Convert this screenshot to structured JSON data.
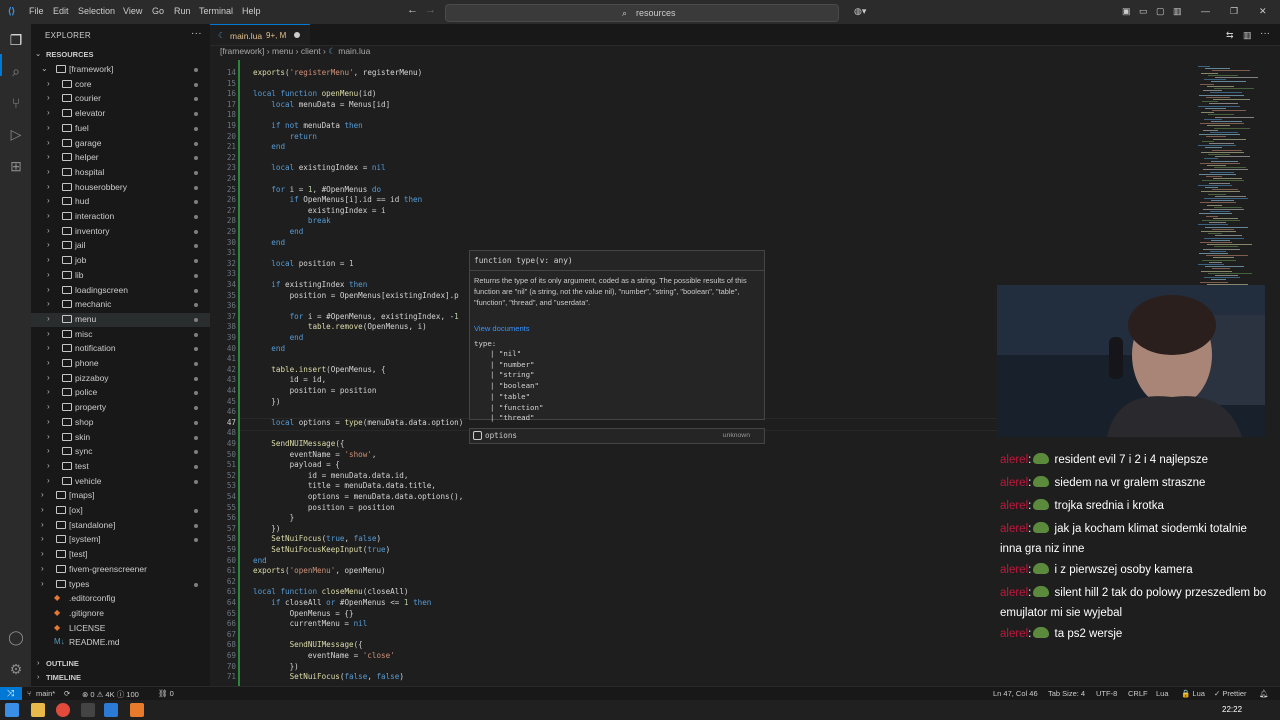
{
  "menubar": {
    "items": [
      "File",
      "Edit",
      "Selection",
      "View",
      "Go",
      "Run",
      "Terminal",
      "Help"
    ],
    "search_text": "resources"
  },
  "sidebar": {
    "title": "EXPLORER",
    "root": "RESOURCES",
    "tree": [
      {
        "label": "[framework]",
        "type": "folder",
        "open": true,
        "depth": 1,
        "dot": true
      },
      {
        "label": "core",
        "type": "folder",
        "depth": 2,
        "dot": true
      },
      {
        "label": "courier",
        "type": "folder",
        "depth": 2,
        "dot": true
      },
      {
        "label": "elevator",
        "type": "folder",
        "depth": 2,
        "dot": true
      },
      {
        "label": "fuel",
        "type": "folder",
        "depth": 2,
        "dot": true
      },
      {
        "label": "garage",
        "type": "folder",
        "depth": 2,
        "dot": true
      },
      {
        "label": "helper",
        "type": "folder",
        "depth": 2,
        "dot": true
      },
      {
        "label": "hospital",
        "type": "folder",
        "depth": 2,
        "dot": true
      },
      {
        "label": "houserobbery",
        "type": "folder",
        "depth": 2,
        "dot": true
      },
      {
        "label": "hud",
        "type": "folder",
        "depth": 2,
        "dot": true
      },
      {
        "label": "interaction",
        "type": "folder",
        "depth": 2,
        "dot": true
      },
      {
        "label": "inventory",
        "type": "folder",
        "depth": 2,
        "dot": true
      },
      {
        "label": "jail",
        "type": "folder",
        "depth": 2,
        "dot": true
      },
      {
        "label": "job",
        "type": "folder",
        "depth": 2,
        "dot": true
      },
      {
        "label": "lib",
        "type": "folder",
        "depth": 2,
        "dot": true
      },
      {
        "label": "loadingscreen",
        "type": "folder",
        "depth": 2,
        "dot": true
      },
      {
        "label": "mechanic",
        "type": "folder",
        "depth": 2,
        "dot": true
      },
      {
        "label": "menu",
        "type": "folder",
        "depth": 2,
        "dot": true,
        "selected": true
      },
      {
        "label": "misc",
        "type": "folder",
        "depth": 2,
        "dot": true
      },
      {
        "label": "notification",
        "type": "folder",
        "depth": 2,
        "dot": true
      },
      {
        "label": "phone",
        "type": "folder",
        "depth": 2,
        "dot": true
      },
      {
        "label": "pizzaboy",
        "type": "folder",
        "depth": 2,
        "dot": true
      },
      {
        "label": "police",
        "type": "folder",
        "depth": 2,
        "dot": true
      },
      {
        "label": "property",
        "type": "folder",
        "depth": 2,
        "dot": true
      },
      {
        "label": "shop",
        "type": "folder",
        "depth": 2,
        "dot": true
      },
      {
        "label": "skin",
        "type": "folder",
        "depth": 2,
        "dot": true
      },
      {
        "label": "sync",
        "type": "folder",
        "depth": 2,
        "dot": true
      },
      {
        "label": "test",
        "type": "folder",
        "depth": 2,
        "dot": true
      },
      {
        "label": "vehicle",
        "type": "folder",
        "depth": 2,
        "dot": true
      },
      {
        "label": "[maps]",
        "type": "folder",
        "depth": 1,
        "dot": false
      },
      {
        "label": "[ox]",
        "type": "folder",
        "depth": 1,
        "dot": true
      },
      {
        "label": "[standalone]",
        "type": "folder",
        "depth": 1,
        "dot": true
      },
      {
        "label": "[system]",
        "type": "folder",
        "depth": 1,
        "dot": true
      },
      {
        "label": "[test]",
        "type": "folder",
        "depth": 1,
        "dot": false
      },
      {
        "label": "fivem-greenscreener",
        "type": "folder",
        "depth": 1,
        "dot": false
      },
      {
        "label": "types",
        "type": "folder",
        "depth": 1,
        "dot": true
      },
      {
        "label": ".editorconfig",
        "type": "file",
        "depth": 1,
        "dot": false
      },
      {
        "label": ".gitignore",
        "type": "file",
        "depth": 1,
        "dot": false
      },
      {
        "label": "LICENSE",
        "type": "file",
        "depth": 1,
        "dot": false
      },
      {
        "label": "README.md",
        "type": "file",
        "depth": 1,
        "dot": false,
        "prefix": "M↓"
      }
    ],
    "outline_label": "OUTLINE",
    "timeline_label": "TIMELINE"
  },
  "tab": {
    "label": "main.lua",
    "badge": "9+, M"
  },
  "breadcrumb": [
    "[framework]",
    "menu",
    "client",
    "main.lua"
  ],
  "editor": {
    "current_line": 47,
    "lines": [
      {
        "n": 14,
        "t": "exports('registerMenu', registerMenu)"
      },
      {
        "n": 15,
        "t": ""
      },
      {
        "n": 16,
        "t": "local function openMenu(id)"
      },
      {
        "n": 17,
        "t": "    local menuData = Menus[id]"
      },
      {
        "n": 18,
        "t": ""
      },
      {
        "n": 19,
        "t": "    if not menuData then"
      },
      {
        "n": 20,
        "t": "        return"
      },
      {
        "n": 21,
        "t": "    end"
      },
      {
        "n": 22,
        "t": ""
      },
      {
        "n": 23,
        "t": "    local existingIndex = nil"
      },
      {
        "n": 24,
        "t": ""
      },
      {
        "n": 25,
        "t": "    for i = 1, #OpenMenus do"
      },
      {
        "n": 26,
        "t": "        if OpenMenus[i].id == id then"
      },
      {
        "n": 27,
        "t": "            existingIndex = i"
      },
      {
        "n": 28,
        "t": "            break"
      },
      {
        "n": 29,
        "t": "        end"
      },
      {
        "n": 30,
        "t": "    end"
      },
      {
        "n": 31,
        "t": ""
      },
      {
        "n": 32,
        "t": "    local position = 1"
      },
      {
        "n": 33,
        "t": ""
      },
      {
        "n": 34,
        "t": "    if existingIndex then"
      },
      {
        "n": 35,
        "t": "        position = OpenMenus[existingIndex].p"
      },
      {
        "n": 36,
        "t": ""
      },
      {
        "n": 37,
        "t": "        for i = #OpenMenus, existingIndex, -1"
      },
      {
        "n": 38,
        "t": "            table.remove(OpenMenus, i)"
      },
      {
        "n": 39,
        "t": "        end"
      },
      {
        "n": 40,
        "t": "    end"
      },
      {
        "n": 41,
        "t": ""
      },
      {
        "n": 42,
        "t": "    table.insert(OpenMenus, {"
      },
      {
        "n": 43,
        "t": "        id = id,"
      },
      {
        "n": 44,
        "t": "        position = position"
      },
      {
        "n": 45,
        "t": "    })"
      },
      {
        "n": 46,
        "t": ""
      },
      {
        "n": 47,
        "t": "    local options = type(menuData.data.option)"
      },
      {
        "n": 48,
        "t": ""
      },
      {
        "n": 49,
        "t": "    SendNUIMessage({"
      },
      {
        "n": 50,
        "t": "        eventName = 'show',"
      },
      {
        "n": 51,
        "t": "        payload = {"
      },
      {
        "n": 52,
        "t": "            id = menuData.data.id,"
      },
      {
        "n": 53,
        "t": "            title = menuData.data.title,"
      },
      {
        "n": 54,
        "t": "            options = menuData.data.options(),"
      },
      {
        "n": 55,
        "t": "            position = position"
      },
      {
        "n": 56,
        "t": "        }"
      },
      {
        "n": 57,
        "t": "    })"
      },
      {
        "n": 58,
        "t": "    SetNuiFocus(true, false)"
      },
      {
        "n": 59,
        "t": "    SetNuiFocusKeepInput(true)"
      },
      {
        "n": 60,
        "t": "end"
      },
      {
        "n": 61,
        "t": "exports('openMenu', openMenu)"
      },
      {
        "n": 62,
        "t": ""
      },
      {
        "n": 63,
        "t": "local function closeMenu(closeAll)"
      },
      {
        "n": 64,
        "t": "    if closeAll or #OpenMenus <= 1 then"
      },
      {
        "n": 65,
        "t": "        OpenMenus = {}"
      },
      {
        "n": 66,
        "t": "        currentMenu = nil"
      },
      {
        "n": 67,
        "t": ""
      },
      {
        "n": 68,
        "t": "        SendNUIMessage({"
      },
      {
        "n": 69,
        "t": "            eventName = 'close'"
      },
      {
        "n": 70,
        "t": "        })"
      },
      {
        "n": 71,
        "t": "        SetNuiFocus(false, false)"
      }
    ]
  },
  "hover": {
    "signature": "function type(v: any)",
    "description": "Returns the type of its only argument, coded as a string. The possible results of this function are \"nil\" (a string, not the value nil), \"number\", \"string\", \"boolean\", \"table\", \"function\", \"thread\", and \"userdata\".",
    "link": "View documents",
    "type_label": "type:",
    "type_values": [
      "| \"nil\"",
      "| \"number\"",
      "| \"string\"",
      "| \"boolean\"",
      "| \"table\"",
      "| \"function\"",
      "| \"thread\""
    ]
  },
  "suggest": {
    "label": "options",
    "detail": "unknown"
  },
  "chat": {
    "user": "alerel",
    "messages": [
      "resident evil 7 i 2 i 4 najlepsze",
      "siedem na vr gralem straszne",
      "trojka srednia i krotka",
      "jak ja kocham klimat siodemki totalnie inna gra niz inne",
      "i z pierwszej osoby kamera",
      "silent hill 2 tak do polowy przeszedlem bo emujlator mi sie wyjebal",
      "ta ps2 wersje"
    ]
  },
  "statusbar": {
    "branch": "main*",
    "problems": "⊗ 0 ⚠ 4K ⓘ 100",
    "ports": "⛓ 0",
    "position": "Ln 47, Col 46",
    "tab_size": "Tab Size: 4",
    "encoding": "UTF-8",
    "eol": "CRLF",
    "language": "Lua",
    "formatter_lang": "🔒 Lua",
    "prettier": "✓ Prettier"
  },
  "taskbar": {
    "time": "22:22"
  },
  "colors": {
    "accent": "#0078d4",
    "chat_user": "#c0173c"
  }
}
